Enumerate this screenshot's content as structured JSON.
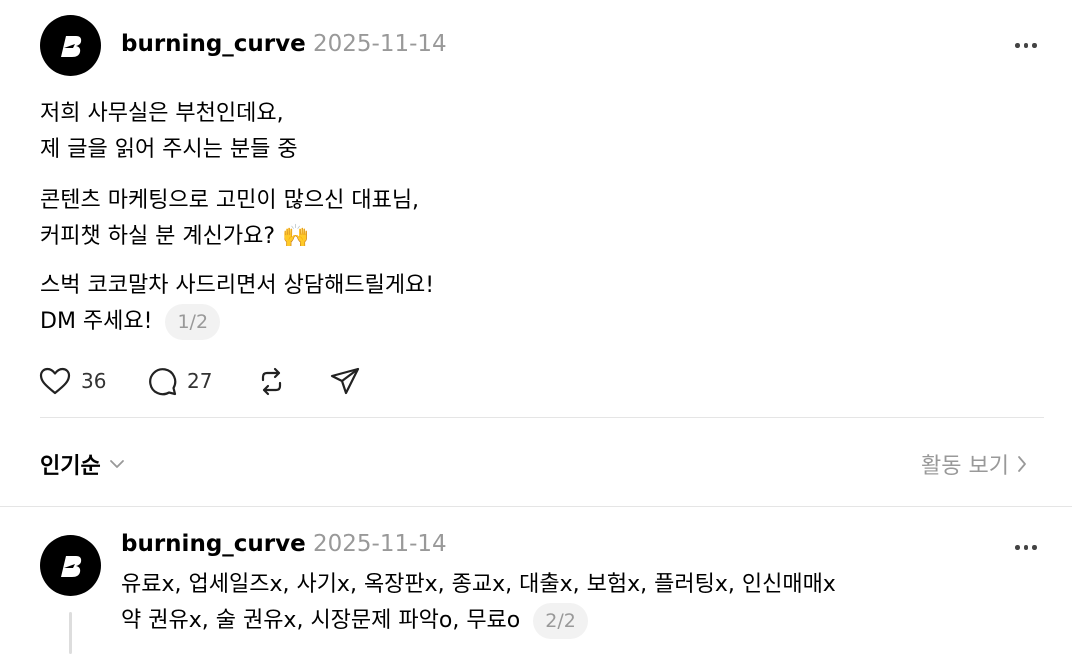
{
  "post": {
    "username": "burning_curve",
    "date": "2025-11-14",
    "lines": [
      "저희 사무실은 부천인데요,",
      "제 글을 읽어 주시는 분들 중",
      "콘텐츠 마케팅으로 고민이 많으신 대표님,",
      "커피챗 하실 분 계신가요? 🙌",
      "스벅 코코말차 사드리면서 상담해드릴게요!",
      "DM 주세요!"
    ],
    "pager": "1/2",
    "likes": "36",
    "comments": "27"
  },
  "sort_bar": {
    "sort_label": "인기순",
    "activity_label": "활동 보기"
  },
  "reply": {
    "username": "burning_curve",
    "date": "2025-11-14",
    "lines": [
      "유료x, 업세일즈x, 사기x, 옥장판x, 종교x, 대출x, 보험x, 플러팅x, 인신매매x",
      "약 권유x, 술 권유x, 시장문제 파악o, 무료o"
    ],
    "pager": "2/2"
  },
  "icons": [
    "logo-icon",
    "more-icon",
    "heart-icon",
    "comment-icon",
    "repost-icon",
    "share-icon",
    "chevron-down-icon",
    "chevron-right-icon"
  ],
  "colors": {
    "muted": "#999999",
    "divider": "#e5e5e5",
    "text": "#000000"
  }
}
